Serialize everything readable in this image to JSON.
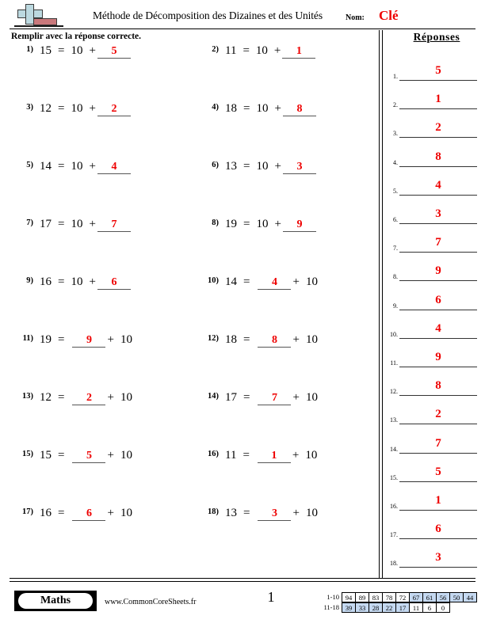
{
  "header": {
    "logo": "plus-blocks-logo",
    "title": "Méthode de Décomposition des Dizaines et des Unités",
    "name_label": "Nom:",
    "name_value": "Clé",
    "name_color": "#ee0000"
  },
  "instruction": "Remplir avec la réponse correcte.",
  "answers_header": "Réponses",
  "problems": [
    {
      "num": "1)",
      "left": "15",
      "eq": "=",
      "a": "10",
      "plus": "+",
      "blank": "5",
      "blank_pos": "right"
    },
    {
      "num": "2)",
      "left": "11",
      "eq": "=",
      "a": "10",
      "plus": "+",
      "blank": "1",
      "blank_pos": "right"
    },
    {
      "num": "3)",
      "left": "12",
      "eq": "=",
      "a": "10",
      "plus": "+",
      "blank": "2",
      "blank_pos": "right"
    },
    {
      "num": "4)",
      "left": "18",
      "eq": "=",
      "a": "10",
      "plus": "+",
      "blank": "8",
      "blank_pos": "right"
    },
    {
      "num": "5)",
      "left": "14",
      "eq": "=",
      "a": "10",
      "plus": "+",
      "blank": "4",
      "blank_pos": "right"
    },
    {
      "num": "6)",
      "left": "13",
      "eq": "=",
      "a": "10",
      "plus": "+",
      "blank": "3",
      "blank_pos": "right"
    },
    {
      "num": "7)",
      "left": "17",
      "eq": "=",
      "a": "10",
      "plus": "+",
      "blank": "7",
      "blank_pos": "right"
    },
    {
      "num": "8)",
      "left": "19",
      "eq": "=",
      "a": "10",
      "plus": "+",
      "blank": "9",
      "blank_pos": "right"
    },
    {
      "num": "9)",
      "left": "16",
      "eq": "=",
      "a": "10",
      "plus": "+",
      "blank": "6",
      "blank_pos": "right"
    },
    {
      "num": "10)",
      "left": "14",
      "eq": "=",
      "a": "10",
      "plus": "+",
      "blank": "4",
      "blank_pos": "left"
    },
    {
      "num": "11)",
      "left": "19",
      "eq": "=",
      "a": "10",
      "plus": "+",
      "blank": "9",
      "blank_pos": "left"
    },
    {
      "num": "12)",
      "left": "18",
      "eq": "=",
      "a": "10",
      "plus": "+",
      "blank": "8",
      "blank_pos": "left"
    },
    {
      "num": "13)",
      "left": "12",
      "eq": "=",
      "a": "10",
      "plus": "+",
      "blank": "2",
      "blank_pos": "left"
    },
    {
      "num": "14)",
      "left": "17",
      "eq": "=",
      "a": "10",
      "plus": "+",
      "blank": "7",
      "blank_pos": "left"
    },
    {
      "num": "15)",
      "left": "15",
      "eq": "=",
      "a": "10",
      "plus": "+",
      "blank": "5",
      "blank_pos": "left"
    },
    {
      "num": "16)",
      "left": "11",
      "eq": "=",
      "a": "10",
      "plus": "+",
      "blank": "1",
      "blank_pos": "left"
    },
    {
      "num": "17)",
      "left": "16",
      "eq": "=",
      "a": "10",
      "plus": "+",
      "blank": "6",
      "blank_pos": "left"
    },
    {
      "num": "18)",
      "left": "13",
      "eq": "=",
      "a": "10",
      "plus": "+",
      "blank": "3",
      "blank_pos": "left"
    }
  ],
  "answers": [
    {
      "num": "1.",
      "value": "5"
    },
    {
      "num": "2.",
      "value": "1"
    },
    {
      "num": "3.",
      "value": "2"
    },
    {
      "num": "4.",
      "value": "8"
    },
    {
      "num": "5.",
      "value": "4"
    },
    {
      "num": "6.",
      "value": "3"
    },
    {
      "num": "7.",
      "value": "7"
    },
    {
      "num": "8.",
      "value": "9"
    },
    {
      "num": "9.",
      "value": "6"
    },
    {
      "num": "10.",
      "value": "4"
    },
    {
      "num": "11.",
      "value": "9"
    },
    {
      "num": "12.",
      "value": "8"
    },
    {
      "num": "13.",
      "value": "2"
    },
    {
      "num": "14.",
      "value": "7"
    },
    {
      "num": "15.",
      "value": "5"
    },
    {
      "num": "16.",
      "value": "1"
    },
    {
      "num": "17.",
      "value": "6"
    },
    {
      "num": "18.",
      "value": "3"
    }
  ],
  "footer": {
    "subject_badge": "Maths",
    "website": "www.CommonCoreSheets.fr",
    "page_number": "1",
    "grade_scale": {
      "rows": [
        {
          "label": "1-10",
          "cells": [
            {
              "v": "94",
              "shaded": false
            },
            {
              "v": "89",
              "shaded": false
            },
            {
              "v": "83",
              "shaded": false
            },
            {
              "v": "78",
              "shaded": false
            },
            {
              "v": "72",
              "shaded": false
            },
            {
              "v": "67",
              "shaded": true
            },
            {
              "v": "61",
              "shaded": true
            },
            {
              "v": "56",
              "shaded": true
            },
            {
              "v": "50",
              "shaded": true
            },
            {
              "v": "44",
              "shaded": true
            }
          ]
        },
        {
          "label": "11-18",
          "cells": [
            {
              "v": "39",
              "shaded": true
            },
            {
              "v": "33",
              "shaded": true
            },
            {
              "v": "28",
              "shaded": true
            },
            {
              "v": "22",
              "shaded": true
            },
            {
              "v": "17",
              "shaded": true
            },
            {
              "v": "11",
              "shaded": false
            },
            {
              "v": "6",
              "shaded": false
            },
            {
              "v": "0",
              "shaded": false
            }
          ]
        }
      ]
    }
  },
  "colors": {
    "answer_red": "#ee0000",
    "logo_blue": "#bcd9e0",
    "logo_red": "#c9797c",
    "grade_shade": "#c5d9f1"
  }
}
